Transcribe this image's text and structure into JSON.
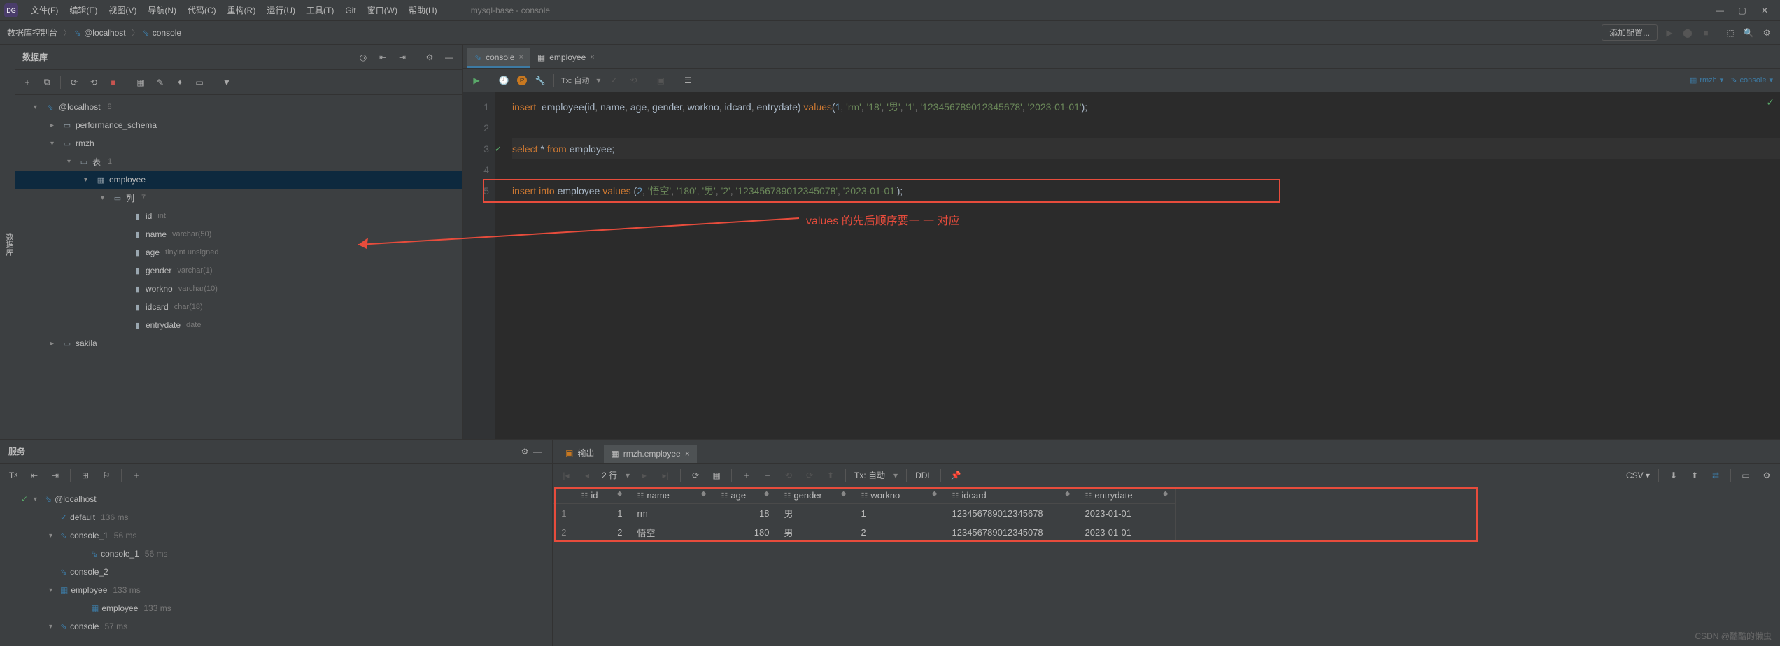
{
  "window": {
    "title": "mysql-base - console"
  },
  "menu": [
    "文件(F)",
    "编辑(E)",
    "视图(V)",
    "导航(N)",
    "代码(C)",
    "重构(R)",
    "运行(U)",
    "工具(T)",
    "Git",
    "窗口(W)",
    "帮助(H)"
  ],
  "nav": {
    "crumb1": "数据库控制台",
    "crumb2": "@localhost",
    "crumb3": "console",
    "addcfg": "添加配置..."
  },
  "db_panel": {
    "title": "数据库",
    "root": "@localhost",
    "root_n": "8",
    "items": [
      {
        "lbl": "performance_schema",
        "icon": "▭",
        "ind": 2,
        "arrow": "▸"
      },
      {
        "lbl": "rmzh",
        "icon": "▭",
        "ind": 2,
        "arrow": "▾"
      },
      {
        "lbl": "表",
        "num": "1",
        "icon": "▭",
        "ind": 3,
        "arrow": "▾"
      },
      {
        "lbl": "employee",
        "icon": "▦",
        "ind": 4,
        "arrow": "▾",
        "sel": true
      },
      {
        "lbl": "列",
        "num": "7",
        "icon": "▭",
        "ind": 5,
        "arrow": "▾"
      },
      {
        "lbl": "id",
        "type": "int",
        "icon": "▮",
        "ind": 6
      },
      {
        "lbl": "name",
        "type": "varchar(50)",
        "icon": "▮",
        "ind": 6
      },
      {
        "lbl": "age",
        "type": "tinyint unsigned",
        "icon": "▮",
        "ind": 6
      },
      {
        "lbl": "gender",
        "type": "varchar(1)",
        "icon": "▮",
        "ind": 6
      },
      {
        "lbl": "workno",
        "type": "varchar(10)",
        "icon": "▮",
        "ind": 6
      },
      {
        "lbl": "idcard",
        "type": "char(18)",
        "icon": "▮",
        "ind": 6
      },
      {
        "lbl": "entrydate",
        "type": "date",
        "icon": "▮",
        "ind": 6
      },
      {
        "lbl": "sakila",
        "icon": "▭",
        "ind": 2,
        "arrow": "▸"
      }
    ]
  },
  "editor": {
    "tabs": [
      {
        "label": "console",
        "active": true
      },
      {
        "label": "employee",
        "active": false
      }
    ],
    "tx": "Tx: 自动",
    "schema": "rmzh",
    "console": "console",
    "code": {
      "l1": {
        "text": "insert  employee(id, name, age, gender, workno, idcard, entrydate) values(1, 'rm', '18', '男', '1', '123456789012345678', '2023-01-01');"
      },
      "l3": {
        "text": "select * from employee;"
      },
      "l5": {
        "text": "insert into employee values (2, '悟空', '180', '男', '2', '123456789012345078', '2023-01-01');"
      }
    },
    "annotation": "values 的先后顺序要一 一 对应"
  },
  "services": {
    "title": "服务",
    "tree": [
      {
        "lbl": "@localhost",
        "ind": 1,
        "arrow": "▾",
        "icon": "⇘"
      },
      {
        "lbl": "default",
        "time": "136 ms",
        "ind": 2,
        "icon": "✓"
      },
      {
        "lbl": "console_1",
        "time": "56 ms",
        "ind": 2,
        "arrow": "▾",
        "icon": "⇘"
      },
      {
        "lbl": "console_1",
        "time": "56 ms",
        "ind": 3,
        "icon": "⇘"
      },
      {
        "lbl": "console_2",
        "ind": 2,
        "icon": "⇘"
      },
      {
        "lbl": "employee",
        "time": "133 ms",
        "ind": 2,
        "arrow": "▾",
        "icon": "▦"
      },
      {
        "lbl": "employee",
        "time": "133 ms",
        "ind": 3,
        "icon": "▦"
      },
      {
        "lbl": "console",
        "time": "57 ms",
        "ind": 2,
        "arrow": "▾",
        "icon": "⇘"
      }
    ]
  },
  "result": {
    "tabs": [
      {
        "label": "输出",
        "active": false,
        "icon": "▣"
      },
      {
        "label": "rmzh.employee",
        "active": true,
        "icon": "▦"
      }
    ],
    "rows_lbl": "2 行",
    "tx": "Tx: 自动",
    "ddl": "DDL",
    "csv": "CSV",
    "cols": [
      "id",
      "name",
      "age",
      "gender",
      "workno",
      "idcard",
      "entrydate"
    ],
    "data": [
      {
        "n": "1",
        "id": "1",
        "name": "rm",
        "age": "18",
        "gender": "男",
        "workno": "1",
        "idcard": "123456789012345678",
        "entrydate": "2023-01-01"
      },
      {
        "n": "2",
        "id": "2",
        "name": "悟空",
        "age": "180",
        "gender": "男",
        "workno": "2",
        "idcard": "123456789012345078",
        "entrydate": "2023-01-01"
      }
    ]
  },
  "watermark": "CSDN @酷酷的懒虫",
  "vstrip": "数据库"
}
